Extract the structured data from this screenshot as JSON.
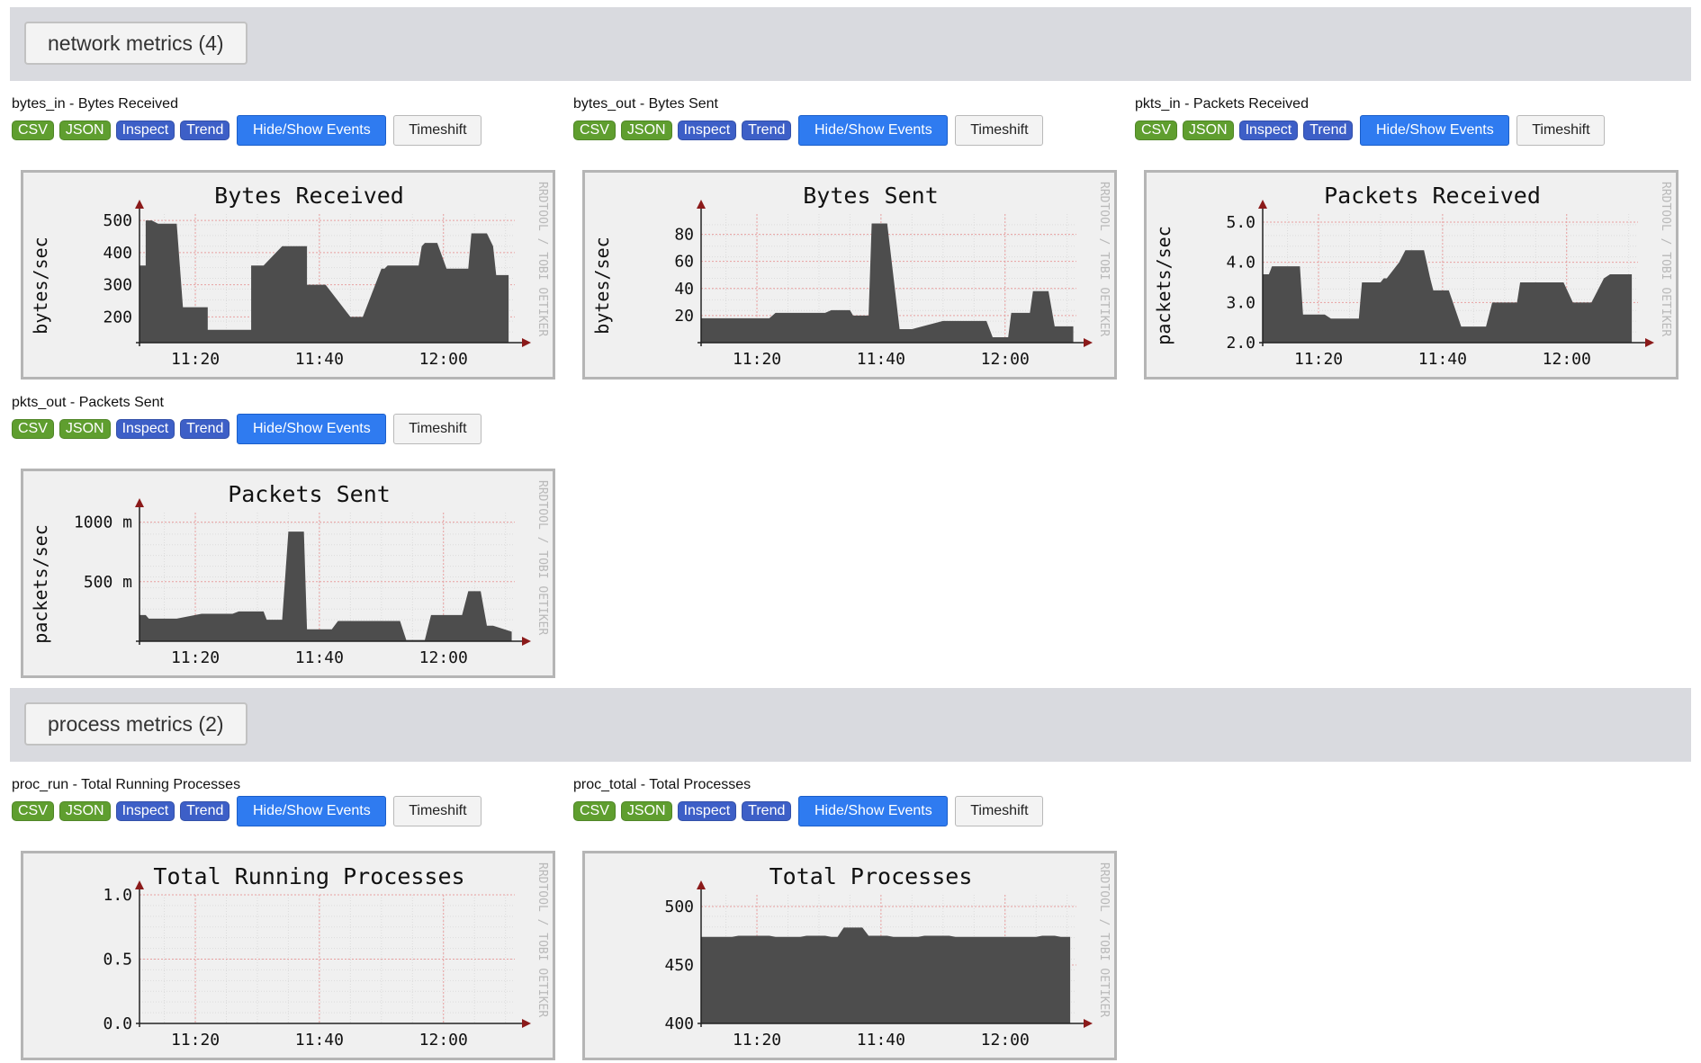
{
  "sections": [
    {
      "label": "network metrics (4)"
    },
    {
      "label": "process metrics (2)"
    }
  ],
  "buttons": {
    "csv": "CSV",
    "json": "JSON",
    "inspect": "Inspect",
    "trend": "Trend",
    "events": "Hide/Show Events",
    "timeshift": "Timeshift"
  },
  "watermark": "RRDTOOL / TOBI OETIKER",
  "colors": {
    "section_bg": "#d9dadf",
    "csv_json_green": "#5f9e2f",
    "inspect_trend_blue": "#3d5fc7",
    "events_button_blue": "#2f7bf0",
    "area_fill": "#4d4d4d",
    "grid_red": "#e8a0a0",
    "arrow_red": "#8b1a1a"
  },
  "graphs": [
    {
      "title": "bytes_in - Bytes Received"
    },
    {
      "title": "bytes_out - Bytes Sent"
    },
    {
      "title": "pkts_in - Packets Received"
    },
    {
      "title": "pkts_out - Packets Sent"
    },
    {
      "title": "proc_run - Total Running Processes"
    },
    {
      "title": "proc_total - Total Processes"
    }
  ],
  "chart_data": [
    {
      "type": "area",
      "title": "Bytes Received",
      "ylabel": "bytes/sec",
      "xlabel": "",
      "x_ticks": [
        "11:20",
        "11:40",
        "12:00"
      ],
      "y_ticks": [
        "200",
        "300",
        "400",
        "500"
      ],
      "y_tick_values": [
        200,
        300,
        400,
        500
      ],
      "ylim": [
        120,
        520
      ],
      "x_range": [
        "11:11",
        "11:71.5"
      ],
      "series": [
        {
          "x": [
            11,
            12,
            12,
            13,
            13.5,
            14,
            17,
            18,
            18,
            20,
            21,
            22,
            22,
            25,
            25.5,
            26,
            28,
            29,
            29,
            31,
            33,
            34,
            35,
            38,
            38,
            39,
            41,
            45,
            45,
            46,
            47,
            50,
            50.5,
            51,
            52,
            56,
            56.5,
            57,
            59,
            60.5,
            61,
            63,
            64,
            64.5,
            66,
            67,
            68,
            68.5,
            69,
            70.5
          ],
          "y": [
            360,
            360,
            500,
            500,
            495,
            490,
            490,
            230,
            230,
            230,
            230,
            230,
            160,
            160,
            160,
            160,
            160,
            160,
            360,
            360,
            400,
            420,
            420,
            420,
            300,
            300,
            300,
            200,
            200,
            200,
            200,
            350,
            350,
            360,
            360,
            360,
            420,
            430,
            430,
            350,
            350,
            350,
            350,
            460,
            460,
            460,
            420,
            330,
            330,
            330
          ]
        }
      ]
    },
    {
      "type": "area",
      "title": "Bytes Sent",
      "ylabel": "bytes/sec",
      "xlabel": "",
      "x_ticks": [
        "11:20",
        "11:40",
        "12:00"
      ],
      "y_ticks": [
        "20",
        "40",
        "60",
        "80"
      ],
      "y_tick_values": [
        20,
        40,
        60,
        80
      ],
      "ylim": [
        0,
        95
      ],
      "x_range": [
        "11:11",
        "11:71.5"
      ],
      "series": [
        {
          "x": [
            11,
            17,
            18,
            22,
            23,
            26,
            27,
            31,
            32,
            34,
            35,
            35.5,
            36,
            38,
            38.5,
            40,
            40.5,
            41,
            43,
            44,
            45,
            50,
            50.5,
            51,
            53,
            54,
            54.5,
            57,
            58,
            59,
            60.5,
            61,
            63,
            64,
            64.5,
            66,
            67,
            68,
            71
          ],
          "y": [
            18,
            18,
            18,
            18,
            22,
            22,
            22,
            22,
            24,
            24,
            24,
            20,
            20,
            20,
            88,
            88,
            88,
            88,
            10,
            10,
            10,
            16,
            16,
            16,
            16,
            16,
            16,
            16,
            4,
            4,
            4,
            22,
            22,
            22,
            38,
            38,
            38,
            12,
            12
          ]
        }
      ]
    },
    {
      "type": "area",
      "title": "Packets Received",
      "ylabel": "packets/sec",
      "xlabel": "",
      "x_ticks": [
        "11:20",
        "11:40",
        "12:00"
      ],
      "y_ticks": [
        "2.0",
        "3.0",
        "4.0",
        "5.0"
      ],
      "y_tick_values": [
        2.0,
        3.0,
        4.0,
        5.0
      ],
      "ylim": [
        2.0,
        5.2
      ],
      "x_range": [
        "11:11",
        "11:71.5"
      ],
      "series": [
        {
          "x": [
            11,
            12,
            12.5,
            14,
            17,
            17.5,
            18,
            21,
            22,
            26,
            26.5,
            27,
            30,
            30.5,
            31,
            33,
            34,
            35,
            37,
            38,
            38.5,
            40,
            41,
            43,
            44,
            44.5,
            46,
            47,
            48,
            50,
            51,
            52,
            52.5,
            55,
            56,
            56.5,
            58,
            59,
            59.5,
            61,
            63,
            64,
            66,
            67,
            67.5,
            69,
            70.5
          ],
          "y": [
            3.7,
            3.7,
            3.9,
            3.9,
            3.9,
            2.7,
            2.7,
            2.7,
            2.6,
            2.6,
            2.6,
            3.5,
            3.5,
            3.6,
            3.6,
            4.0,
            4.3,
            4.3,
            4.3,
            3.6,
            3.3,
            3.3,
            3.3,
            2.4,
            2.4,
            2.4,
            2.4,
            2.4,
            3.0,
            3.0,
            3.0,
            3.0,
            3.5,
            3.5,
            3.5,
            3.5,
            3.5,
            3.5,
            3.5,
            3.0,
            3.0,
            3.0,
            3.6,
            3.7,
            3.7,
            3.7,
            3.7
          ]
        }
      ]
    },
    {
      "type": "area",
      "title": "Packets Sent",
      "ylabel": "packets/sec",
      "xlabel": "",
      "x_ticks": [
        "11:20",
        "11:40",
        "12:00"
      ],
      "y_ticks": [
        "500 m",
        "1000 m"
      ],
      "y_tick_values": [
        500,
        1000
      ],
      "ylim": [
        0,
        1080
      ],
      "x_range": [
        "11:11",
        "11:71.5"
      ],
      "series": [
        {
          "x": [
            11,
            12,
            12.5,
            16,
            17,
            21,
            22,
            26,
            27,
            31,
            31.5,
            33,
            34,
            35,
            37,
            37.5,
            38,
            41,
            42,
            43,
            44,
            48,
            49,
            53,
            54,
            55,
            57,
            58,
            59,
            60,
            61,
            63,
            64,
            64.5,
            66,
            67,
            68,
            71
          ],
          "y": [
            220,
            220,
            190,
            190,
            190,
            230,
            230,
            230,
            250,
            250,
            180,
            180,
            180,
            920,
            920,
            920,
            100,
            100,
            100,
            170,
            170,
            170,
            170,
            170,
            10,
            10,
            10,
            220,
            220,
            220,
            220,
            220,
            420,
            420,
            420,
            130,
            130,
            80
          ]
        }
      ]
    },
    {
      "type": "area",
      "title": "Total Running Processes",
      "ylabel": "",
      "xlabel": "",
      "x_ticks": [
        "11:20",
        "11:40",
        "12:00"
      ],
      "y_ticks": [
        "0.0",
        "0.5",
        "1.0"
      ],
      "y_tick_values": [
        0.0,
        0.5,
        1.0
      ],
      "ylim": [
        0.0,
        1.0
      ],
      "x_range": [
        "11:11",
        "11:71.5"
      ],
      "series": [
        {
          "x": [
            11,
            70.5
          ],
          "y": [
            0,
            0
          ]
        }
      ]
    },
    {
      "type": "area",
      "title": "Total Processes",
      "ylabel": "",
      "xlabel": "",
      "x_ticks": [
        "11:20",
        "11:40",
        "12:00"
      ],
      "y_ticks": [
        "400",
        "450",
        "500"
      ],
      "y_tick_values": [
        400,
        450,
        500
      ],
      "ylim": [
        400,
        510
      ],
      "x_range": [
        "11:11",
        "11:71.5"
      ],
      "series": [
        {
          "x": [
            11,
            16,
            17,
            22,
            23,
            27,
            28,
            31,
            32,
            33,
            34,
            37,
            38,
            41,
            42,
            46,
            47,
            51,
            52,
            55,
            56,
            60,
            61,
            65,
            66,
            68,
            69,
            70.5
          ],
          "y": [
            474,
            474,
            475,
            475,
            474,
            474,
            475,
            475,
            474,
            474,
            482,
            482,
            475,
            475,
            474,
            474,
            475,
            475,
            474,
            474,
            474,
            474,
            474,
            474,
            475,
            475,
            474,
            474
          ]
        }
      ]
    }
  ]
}
